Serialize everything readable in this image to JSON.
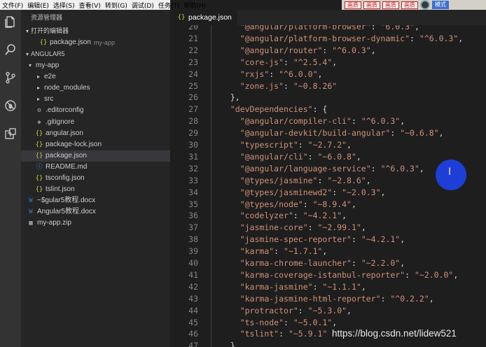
{
  "menubar": {
    "items": [
      "文件(F)",
      "编辑(E)",
      "选择(S)",
      "查看(V)",
      "转到(G)",
      "调试(D)",
      "任务(T)",
      "帮助(H)"
    ]
  },
  "activity_bar": {
    "icons": [
      "files-icon",
      "search-icon",
      "source-control-icon",
      "debug-icon",
      "extensions-icon"
    ]
  },
  "sidebar": {
    "title": "资源管理器",
    "open_editors": {
      "label": "打开的编辑器",
      "items": [
        {
          "name": "package.json",
          "path": "my-app",
          "icon": "json"
        }
      ]
    },
    "workspace": {
      "label": "ANGULAR5",
      "tree": [
        {
          "name": "my-app",
          "depth": 0,
          "icon": "caret-open"
        },
        {
          "name": "e2e",
          "depth": 1,
          "icon": "caret-closed"
        },
        {
          "name": "node_modules",
          "depth": 1,
          "icon": "caret-closed"
        },
        {
          "name": "src",
          "depth": 1,
          "icon": "caret-closed"
        },
        {
          "name": ".editorconfig",
          "depth": 1,
          "icon": "gear"
        },
        {
          "name": ".gitignore",
          "depth": 1,
          "icon": "git"
        },
        {
          "name": "angular.json",
          "depth": 1,
          "icon": "json"
        },
        {
          "name": "package-lock.json",
          "depth": 1,
          "icon": "json"
        },
        {
          "name": "package.json",
          "depth": 1,
          "icon": "json",
          "selected": true
        },
        {
          "name": "README.md",
          "depth": 1,
          "icon": "md"
        },
        {
          "name": "tsconfig.json",
          "depth": 1,
          "icon": "json"
        },
        {
          "name": "tslint.json",
          "depth": 1,
          "icon": "json"
        },
        {
          "name": "~$gular5教程.docx",
          "depth": 0,
          "icon": "docx"
        },
        {
          "name": "Angular5教程.docx",
          "depth": 0,
          "icon": "docx"
        },
        {
          "name": "my-app.zip",
          "depth": 0,
          "icon": "zip"
        }
      ]
    }
  },
  "editor": {
    "tab": {
      "label": "package.json",
      "icon": "json"
    },
    "lines": [
      {
        "n": "20",
        "text": "    \"@angular/platform-browser\": \"6.0.3\","
      },
      {
        "n": "21",
        "text": "    \"@angular/platform-browser-dynamic\": \"^6.0.3\","
      },
      {
        "n": "22",
        "text": "    \"@angular/router\": \"^6.0.3\","
      },
      {
        "n": "23",
        "text": "    \"core-js\": \"^2.5.4\","
      },
      {
        "n": "24",
        "text": "    \"rxjs\": \"^6.0.0\","
      },
      {
        "n": "25",
        "text": "    \"zone.js\": \"~0.8.26\""
      },
      {
        "n": "26",
        "text": "  },"
      },
      {
        "n": "27",
        "text": "  \"devDependencies\": {"
      },
      {
        "n": "28",
        "text": "    \"@angular/compiler-cli\": \"^6.0.3\","
      },
      {
        "n": "29",
        "text": "    \"@angular-devkit/build-angular\": \"~0.6.8\","
      },
      {
        "n": "30",
        "text": "    \"typescript\": \"~2.7.2\","
      },
      {
        "n": "31",
        "text": "    \"@angular/cli\": \"~6.0.8\","
      },
      {
        "n": "32",
        "text": "    \"@angular/language-service\": \"^6.0.3\","
      },
      {
        "n": "33",
        "text": "    \"@types/jasmine\": \"~2.8.6\","
      },
      {
        "n": "34",
        "text": "    \"@types/jasminewd2\": \"~2.0.3\","
      },
      {
        "n": "35",
        "text": "    \"@types/node\": \"~8.9.4\","
      },
      {
        "n": "36",
        "text": "    \"codelyzer\": \"~4.2.1\","
      },
      {
        "n": "37",
        "text": "    \"jasmine-core\": \"~2.99.1\","
      },
      {
        "n": "38",
        "text": "    \"jasmine-spec-reporter\": \"~4.2.1\","
      },
      {
        "n": "39",
        "text": "    \"karma\": \"~1.7.1\","
      },
      {
        "n": "40",
        "text": "    \"karma-chrome-launcher\": \"~2.2.0\","
      },
      {
        "n": "41",
        "text": "    \"karma-coverage-istanbul-reporter\": \"~2.0.0\","
      },
      {
        "n": "42",
        "text": "    \"karma-jasmine\": \"~1.1.1\","
      },
      {
        "n": "43",
        "text": "    \"karma-jasmine-html-reporter\": \"^0.2.2\","
      },
      {
        "n": "44",
        "text": "    \"protractor\": \"~5.3.0\","
      },
      {
        "n": "45",
        "text": "    \"ts-node\": \"~5.0.1\","
      },
      {
        "n": "46",
        "text": "    \"tslint\": \"~5.9.1\""
      },
      {
        "n": "47",
        "text": "  }"
      }
    ]
  },
  "toolbar": {
    "buttons": [
      "画质",
      "画质",
      "画质",
      "画质"
    ],
    "mode_label": "模式"
  },
  "watermark": "https://blog.csdn.net/lidew521",
  "colors": {
    "activity_bar": "#333333",
    "sidebar": "#252526",
    "editor": "#1e1e1e",
    "string": "#ce9178",
    "line_number": "#858585",
    "cursor_highlight": "#1d3fd8"
  }
}
